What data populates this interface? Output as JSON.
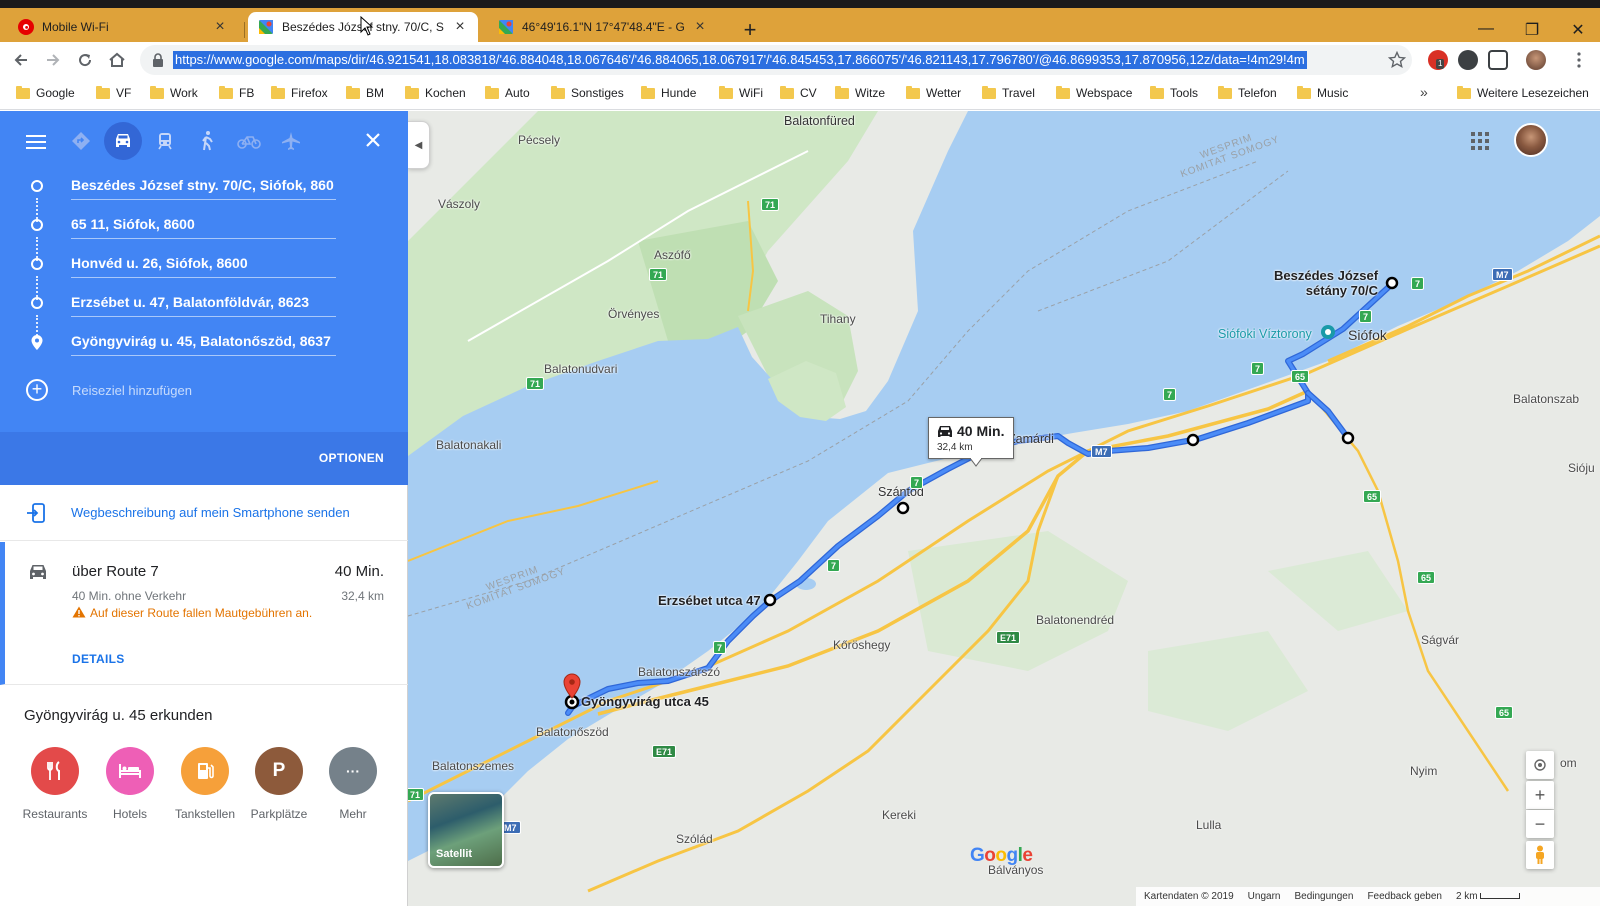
{
  "browser": {
    "tabs": [
      {
        "title": "Mobile Wi-Fi",
        "active": false
      },
      {
        "title": "Beszédes József stny. 70/C, Siófo",
        "active": true
      },
      {
        "title": "46°49'16.1\"N 17°47'48.4\"E - Goo",
        "active": false
      }
    ],
    "new_tab": "+",
    "window_controls": {
      "minimize": "—",
      "maximize": "❐",
      "close": "✕"
    },
    "url": "https://www.google.com/maps/dir/46.921541,18.083818/'46.884048,18.067646'/'46.884065,18.067917'/'46.845453,17.866075'/'46.821143,17.796780'/@46.8699353,17.870956,12z/data=!4m29!4m",
    "ext_badge": "1",
    "bookmarks": [
      "Google",
      "VF",
      "Work",
      "FB",
      "Firefox",
      "BM",
      "Kochen",
      "Auto",
      "Sonstiges",
      "Hunde",
      "WiFi",
      "CV",
      "Witze",
      "Wetter",
      "Travel",
      "Webspace",
      "Tools",
      "Telefon",
      "Music"
    ],
    "bookmarks_more": "»",
    "other_bookmarks": "Weitere Lesezeichen"
  },
  "directions": {
    "stops": [
      "Beszédes József stny. 70/C, Siófok, 860",
      "65 11, Siófok, 8600",
      "Honvéd u. 26, Siófok, 8600",
      "Erzsébet u. 47, Balatonföldvár, 8623",
      "Gyöngyvirág u. 45, Balatonőszöd, 8637"
    ],
    "add_destination": "Reiseziel hinzufügen",
    "options": "OPTIONEN",
    "send_to_phone": "Wegbeschreibung auf mein Smartphone senden",
    "route": {
      "name": "über Route 7",
      "time": "40 Min.",
      "no_traffic": "40 Min. ohne Verkehr",
      "distance": "32,4 km",
      "warning": "Auf dieser Route fallen Mautgebühren an.",
      "details": "DETAILS"
    },
    "explore_title": "Gyöngyvirág u. 45 erkunden",
    "categories": [
      {
        "label": "Restaurants",
        "color": "#e34a4a",
        "icon": "fork-knife-icon"
      },
      {
        "label": "Hotels",
        "color": "#ee5fb6",
        "icon": "bed-icon"
      },
      {
        "label": "Tankstellen",
        "color": "#f6a03a",
        "icon": "gas-pump-icon"
      },
      {
        "label": "Parkplätze",
        "color": "#8d5a3b",
        "icon": "parking-icon",
        "glyph": "P"
      },
      {
        "label": "Mehr",
        "color": "#75818a",
        "icon": "more-icon",
        "glyph": "···"
      }
    ]
  },
  "map": {
    "places": [
      "Balatonfüred",
      "Pécsely",
      "Vászoly",
      "Aszófő",
      "Örvényes",
      "Tihany",
      "Balatonudvari",
      "Balatonakali",
      "Szántód",
      "Zamárdi",
      "Siófok",
      "Balatonszab",
      "Sióju",
      "Kőröshegy",
      "Balatonendréd",
      "Ságvár",
      "Balatonszárszó",
      "Balatonőszöd",
      "Balatonszemes",
      "Kereki",
      "Szólád",
      "Lulla",
      "Nyim",
      "Bálványos",
      "om"
    ],
    "poi": "Siófoki Víztorony",
    "route_labels": {
      "start": "Beszédes József\nsétány 70/C",
      "mid": "Erzsébet utca 47",
      "end": "Gyöngyvirág utca 45"
    },
    "county_labels": [
      "WESPRIM\nKOMITAT SOMOGY",
      "WESPRIM\nKOMITAT SOMOGY"
    ],
    "shields": [
      "71",
      "71",
      "71",
      "7",
      "7",
      "7",
      "7",
      "7",
      "7",
      "7",
      "65",
      "65",
      "65",
      "65",
      "E71",
      "E71",
      "71",
      "M7",
      "M7",
      "M7"
    ],
    "bubble": {
      "time": "40 Min.",
      "distance": "32,4 km"
    },
    "satellite": "Satellit",
    "logo": "Google",
    "zoom_in": "+",
    "zoom_out": "−",
    "footer": {
      "data": "Kartendaten © 2019",
      "region": "Ungarn",
      "terms": "Bedingungen",
      "feedback": "Feedback geben",
      "scale": "2 km"
    },
    "colors": {
      "water": "#a7cdf2",
      "forest": "#c8e6c0",
      "land": "#e8eae6",
      "route": "#4285f4",
      "highway": "#f7c544"
    }
  }
}
